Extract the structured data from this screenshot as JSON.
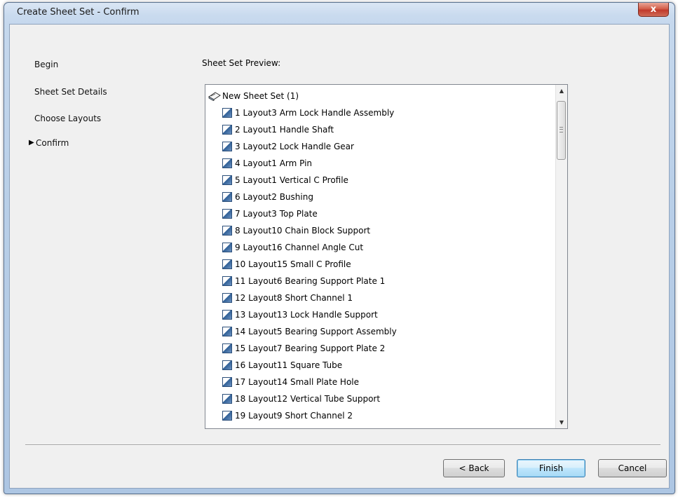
{
  "window": {
    "title": "Create Sheet Set - Confirm",
    "close_label": "x"
  },
  "nav": {
    "items": [
      {
        "label": "Begin",
        "current": false
      },
      {
        "label": "Sheet Set Details",
        "current": false
      },
      {
        "label": "Choose Layouts",
        "current": false
      },
      {
        "label": "Confirm",
        "current": true
      }
    ]
  },
  "preview": {
    "label": "Sheet Set Preview:",
    "root": "New Sheet Set (1)",
    "sheets": [
      "1 Layout3 Arm Lock Handle Assembly",
      "2 Layout1 Handle Shaft",
      "3 Layout2 Lock Handle Gear",
      "4 Layout1 Arm Pin",
      "5 Layout1 Vertical C Profile",
      "6 Layout2 Bushing",
      "7 Layout3 Top Plate",
      "8 Layout10 Chain Block Support",
      "9 Layout16 Channel Angle Cut",
      "10 Layout15 Small C Profile",
      "11 Layout6 Bearing Support Plate 1",
      "12 Layout8 Short Channel 1",
      "13 Layout13 Lock Handle Support",
      "14 Layout5 Bearing Support Assembly",
      "15 Layout7 Bearing Support Plate 2",
      "16 Layout11 Square Tube",
      "17 Layout14 Small Plate Hole",
      "18 Layout12 Vertical Tube Support",
      "19 Layout9 Short Channel 2"
    ]
  },
  "buttons": {
    "back": "< Back",
    "finish": "Finish",
    "cancel": "Cancel"
  }
}
